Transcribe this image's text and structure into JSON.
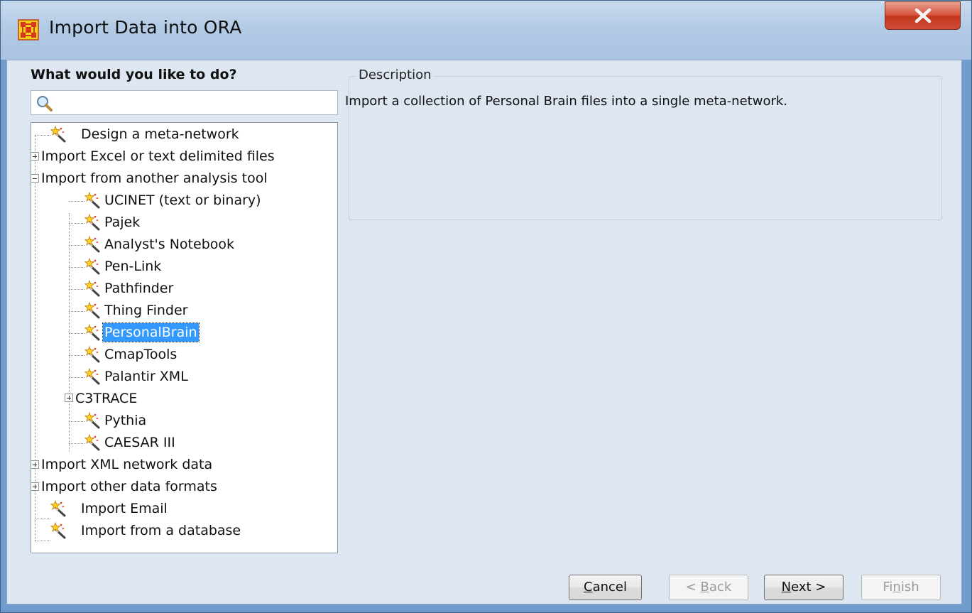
{
  "window": {
    "title": "Import Data into ORA",
    "close_icon": "close-x-icon",
    "app_icon": "ora-network-icon"
  },
  "left_panel": {
    "heading": "What would you like to do?",
    "search": {
      "value": "",
      "placeholder": "",
      "icon": "magnifier-icon"
    }
  },
  "tree": {
    "items": [
      {
        "label": "Design a meta-network",
        "type": "leaf",
        "icon": "magic-wand-icon"
      },
      {
        "label": "Import Excel or text delimited files",
        "type": "collapsed"
      },
      {
        "label": "Import from another analysis tool",
        "type": "expanded"
      },
      {
        "label": "UCINET (text or binary)",
        "type": "leaf",
        "icon": "magic-wand-icon"
      },
      {
        "label": "Pajek",
        "type": "leaf",
        "icon": "magic-wand-icon"
      },
      {
        "label": "Analyst's Notebook",
        "type": "leaf",
        "icon": "magic-wand-icon"
      },
      {
        "label": "Pen-Link",
        "type": "leaf",
        "icon": "magic-wand-icon"
      },
      {
        "label": "Pathfinder",
        "type": "leaf",
        "icon": "magic-wand-icon"
      },
      {
        "label": "Thing Finder",
        "type": "leaf",
        "icon": "magic-wand-icon"
      },
      {
        "label": "PersonalBrain",
        "type": "leaf",
        "icon": "magic-wand-icon",
        "selected": true
      },
      {
        "label": "CmapTools",
        "type": "leaf",
        "icon": "magic-wand-icon"
      },
      {
        "label": "Palantir XML",
        "type": "leaf",
        "icon": "magic-wand-icon"
      },
      {
        "label": "C3TRACE",
        "type": "collapsed"
      },
      {
        "label": "Pythia",
        "type": "leaf",
        "icon": "magic-wand-icon"
      },
      {
        "label": "CAESAR III",
        "type": "leaf",
        "icon": "magic-wand-icon"
      },
      {
        "label": "Import XML network data",
        "type": "collapsed"
      },
      {
        "label": "Import other data formats",
        "type": "collapsed"
      },
      {
        "label": "Import Email",
        "type": "leaf",
        "icon": "magic-wand-icon"
      },
      {
        "label": "Import from a database",
        "type": "leaf",
        "icon": "magic-wand-icon"
      }
    ]
  },
  "description": {
    "legend": "Description",
    "text": "Import a collection of Personal Brain files into a single meta-network."
  },
  "buttons": {
    "cancel": {
      "mnemonic": "C",
      "rest": "ancel"
    },
    "back": {
      "prefix": "< ",
      "mnemonic": "B",
      "rest": "ack",
      "enabled": false
    },
    "next": {
      "mnemonic": "N",
      "rest": "ext >"
    },
    "finish": {
      "prefix": "Fi",
      "mnemonic": "n",
      "rest": "ish",
      "enabled": false
    }
  },
  "colors": {
    "selection": "#3399ff",
    "client_bg": "#dde6f1",
    "close_button": "#c3361f"
  }
}
